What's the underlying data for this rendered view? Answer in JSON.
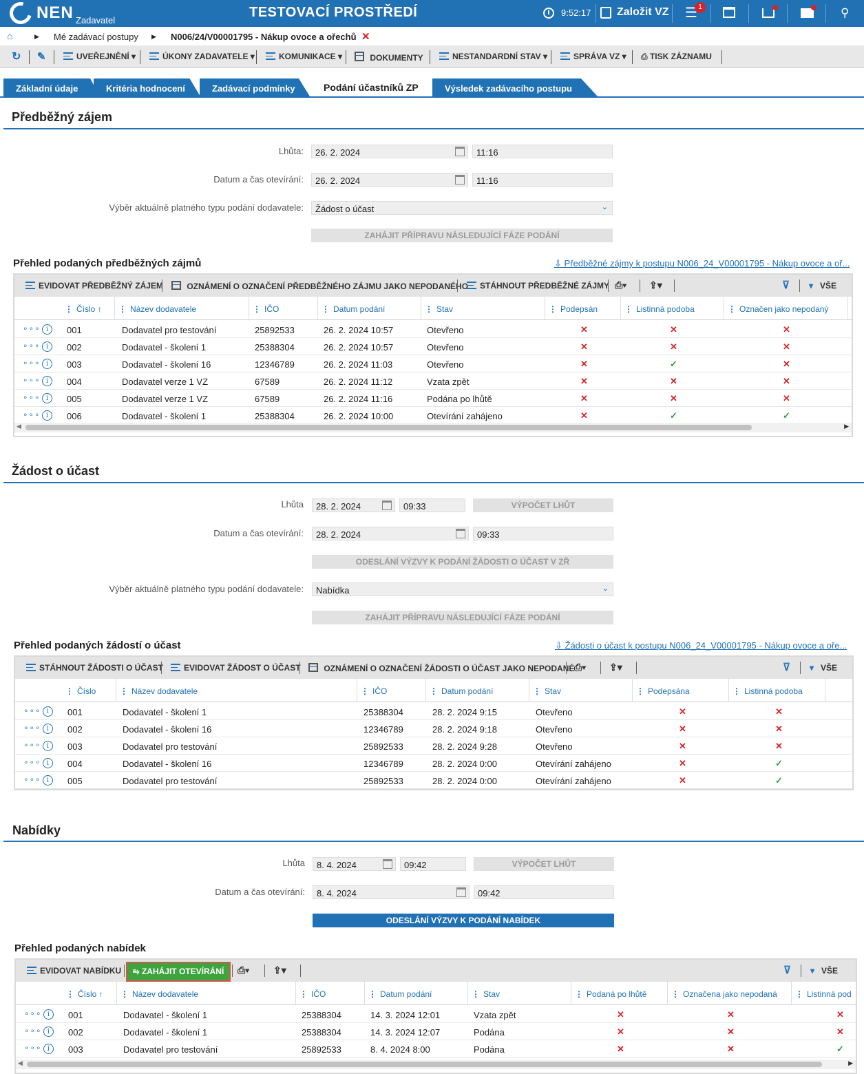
{
  "header": {
    "logo": "NEN",
    "logo_sub": "Zadavatel",
    "env_title": "TESTOVACÍ PROSTŘEDÍ",
    "time": "9:52:17",
    "create_label": "Založit VZ",
    "menu_badge": "1"
  },
  "breadcrumb": {
    "item1": "Mé zadávací postupy",
    "item2": "N006/24/V00001795 - Nákup ovoce a ořechů"
  },
  "toolbar": {
    "uverejneni": "UVEŘEJNĚNÍ",
    "ukony": "ÚKONY ZADAVATELE",
    "komunikace": "KOMUNIKACE",
    "dokumenty": "DOKUMENTY",
    "nestandardni": "NESTANDARDNÍ STAV",
    "sprava": "SPRÁVA VZ",
    "tisk": "TISK ZÁZNAMU"
  },
  "tabs": [
    "Základní údaje",
    "Kritéria hodnocení",
    "Zadávací podmínky",
    "Podání účastníků ZP",
    "Výsledek zadávacího postupu"
  ],
  "s1": {
    "title": "Předběžný zájem",
    "lhuta_label": "Lhůta:",
    "lhuta_date": "26. 2. 2024",
    "lhuta_time": "11:16",
    "otevirani_label": "Datum a čas otevírání:",
    "otevirani_date": "26. 2. 2024",
    "otevirani_time": "11:16",
    "typ_label": "Výběr aktuálně platného typu podání dodavatele:",
    "typ_value": "Žádost o účast",
    "btn_next": "ZAHÁJIT PŘÍPRAVU NÁSLEDUJÍCÍ FÁZE PODÁNÍ",
    "grid_title": "Přehled podaných předběžných zájmů",
    "grid_link": "Předběžné zájmy k postupu N006_24_V00001795 - Nákup ovoce a oř...",
    "tools": [
      "EVIDOVAT PŘEDBĚŽNÝ ZÁJEM",
      "OZNÁMENÍ O OZNAČENÍ PŘEDBĚŽNÉHO ZÁJMU JAKO NEPODANÉHO",
      "STÁHNOUT PŘEDBĚŽNÉ ZÁJMY"
    ],
    "all": "VŠE",
    "headers": [
      "Číslo",
      "Název dodavatele",
      "IČO",
      "Datum podání",
      "Stav",
      "Podepsán",
      "Listinná podoba",
      "Označen jako nepodaný"
    ],
    "rows": [
      {
        "c": "001",
        "n": "Dodavatel pro testování",
        "i": "25892533",
        "d": "26. 2. 2024 10:57",
        "s": "Otevřeno",
        "f": [
          0,
          0,
          0
        ]
      },
      {
        "c": "002",
        "n": "Dodavatel - školení 1",
        "i": "25388304",
        "d": "26. 2. 2024 10:57",
        "s": "Otevřeno",
        "f": [
          0,
          0,
          0
        ]
      },
      {
        "c": "003",
        "n": "Dodavatel - školení 16",
        "i": "12346789",
        "d": "26. 2. 2024 11:03",
        "s": "Otevřeno",
        "f": [
          0,
          1,
          0
        ]
      },
      {
        "c": "004",
        "n": "Dodavatel verze 1 VZ",
        "i": "67589",
        "d": "26. 2. 2024 11:12",
        "s": "Vzata zpět",
        "f": [
          0,
          0,
          0
        ]
      },
      {
        "c": "005",
        "n": "Dodavatel verze 1 VZ",
        "i": "67589",
        "d": "26. 2. 2024 11:16",
        "s": "Podána po lhůtě",
        "f": [
          0,
          0,
          0
        ]
      },
      {
        "c": "006",
        "n": "Dodavatel - školení 1",
        "i": "25388304",
        "d": "26. 2. 2024 10:00",
        "s": "Otevírání zahájeno",
        "f": [
          0,
          1,
          1
        ]
      }
    ]
  },
  "s2": {
    "title": "Žádost o účast",
    "lhuta_label": "Lhůta",
    "lhuta_date": "28. 2. 2024",
    "lhuta_time": "09:33",
    "btn_vypocet": "VÝPOČET LHŮT",
    "otevirani_label": "Datum a čas otevírání:",
    "otevirani_date": "28. 2. 2024",
    "otevirani_time": "09:33",
    "btn_odeslani": "ODESLÁNÍ VÝZVY K PODÁNÍ ŽÁDOSTI O ÚČAST V ZŘ",
    "typ_label": "Výběr aktuálně platného typu podání dodavatele:",
    "typ_value": "Nabídka",
    "btn_next": "ZAHÁJIT PŘÍPRAVU NÁSLEDUJÍCÍ FÁZE PODÁNÍ",
    "grid_title": "Přehled podaných žádostí o účast",
    "grid_link": "Žádosti o účast k postupu N006_24_V00001795 - Nákup ovoce a oře...",
    "tools": [
      "STÁHNOUT ŽÁDOSTI O ÚČAST",
      "EVIDOVAT ŽÁDOST O ÚČAST",
      "OZNÁMENÍ O OZNAČENÍ ŽÁDOSTI O ÚČAST JAKO NEPODANÉ"
    ],
    "all": "VŠE",
    "headers": [
      "Číslo",
      "Název dodavatele",
      "IČO",
      "Datum podání",
      "Stav",
      "Podepsána",
      "Listinná podoba"
    ],
    "rows": [
      {
        "c": "001",
        "n": "Dodavatel - školení 1",
        "i": "25388304",
        "d": "28. 2. 2024 9:15",
        "s": "Otevřeno",
        "f": [
          0,
          0
        ]
      },
      {
        "c": "002",
        "n": "Dodavatel - školení 16",
        "i": "12346789",
        "d": "28. 2. 2024 9:18",
        "s": "Otevřeno",
        "f": [
          0,
          0
        ]
      },
      {
        "c": "003",
        "n": "Dodavatel pro testování",
        "i": "25892533",
        "d": "28. 2. 2024 9:28",
        "s": "Otevřeno",
        "f": [
          0,
          0
        ]
      },
      {
        "c": "004",
        "n": "Dodavatel - školení 16",
        "i": "12346789",
        "d": "28. 2. 2024 0:00",
        "s": "Otevírání zahájeno",
        "f": [
          0,
          1
        ]
      },
      {
        "c": "005",
        "n": "Dodavatel pro testování",
        "i": "25892533",
        "d": "28. 2. 2024 0:00",
        "s": "Otevírání zahájeno",
        "f": [
          0,
          1
        ]
      }
    ]
  },
  "s3": {
    "title": "Nabídky",
    "lhuta_label": "Lhůta",
    "lhuta_date": "8. 4. 2024",
    "lhuta_time": "09:42",
    "btn_vypocet": "VÝPOČET LHŮT",
    "otevirani_label": "Datum a čas otevírání:",
    "otevirani_date": "8. 4. 2024",
    "otevirani_time": "09:42",
    "btn_odeslani": "ODESLÁNÍ VÝZVY K PODÁNÍ NABÍDEK",
    "grid_title": "Přehled podaných nabídek",
    "tools": [
      "EVIDOVAT NABÍDKU",
      "ZAHÁJIT OTEVÍRÁNÍ"
    ],
    "all": "VŠE",
    "headers": [
      "Číslo",
      "Název dodavatele",
      "IČO",
      "Datum podání",
      "Stav",
      "Podaná po lhůtě",
      "Označena jako nepodaná",
      "Listinná pod"
    ],
    "rows": [
      {
        "c": "001",
        "n": "Dodavatel - školení 1",
        "i": "25388304",
        "d": "14. 3. 2024 12:01",
        "s": "Vzata zpět",
        "f": [
          0,
          0,
          0
        ]
      },
      {
        "c": "002",
        "n": "Dodavatel - školení 1",
        "i": "25388304",
        "d": "14. 3. 2024 12:07",
        "s": "Podána",
        "f": [
          0,
          0,
          0
        ]
      },
      {
        "c": "003",
        "n": "Dodavatel pro testování",
        "i": "25892533",
        "d": "8. 4. 2024 8:00",
        "s": "Podána",
        "f": [
          0,
          0,
          1
        ]
      }
    ]
  }
}
